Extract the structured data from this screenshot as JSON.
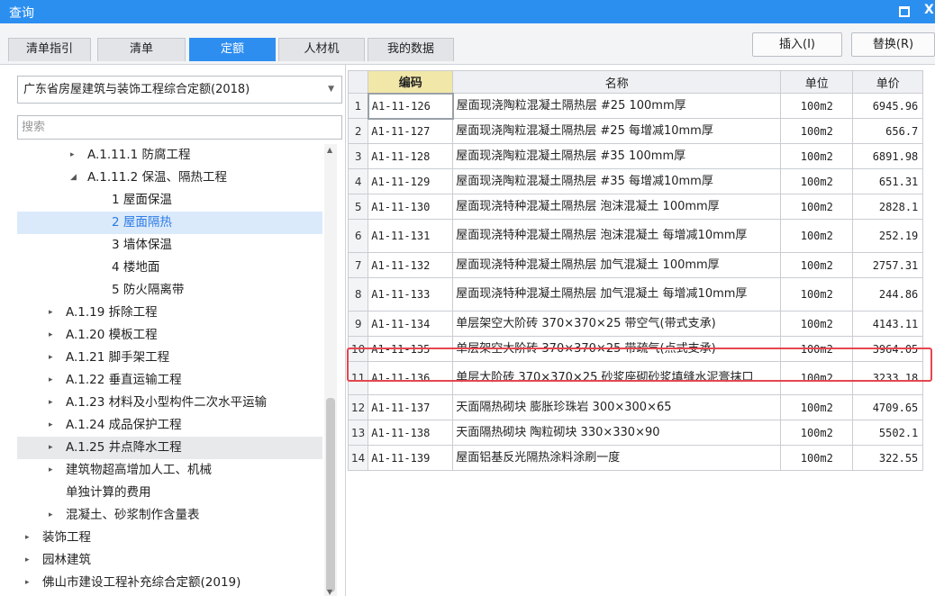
{
  "window": {
    "title": "查询",
    "close_glyph": "X"
  },
  "tabs": [
    {
      "label": "清单指引",
      "active": false
    },
    {
      "label": "清单",
      "active": false
    },
    {
      "label": "定额",
      "active": true
    },
    {
      "label": "人材机",
      "active": false
    },
    {
      "label": "我的数据",
      "active": false
    }
  ],
  "toolbar": {
    "insert_label": "插入(I)",
    "replace_label": "替换(R)"
  },
  "library": {
    "selected": "广东省房屋建筑与装饰工程综合定额(2018)"
  },
  "search": {
    "placeholder": "搜索"
  },
  "tree": [
    {
      "label": "A.1.11.1 防腐工程",
      "arrow": "▸"
    },
    {
      "label": "A.1.11.2 保温、隔热工程",
      "arrow": "◢"
    },
    {
      "label": "1 屋面保温",
      "arrow": ""
    },
    {
      "label": "2 屋面隔热",
      "arrow": ""
    },
    {
      "label": "3 墙体保温",
      "arrow": ""
    },
    {
      "label": "4 楼地面",
      "arrow": ""
    },
    {
      "label": "5 防火隔离带",
      "arrow": ""
    },
    {
      "label": "A.1.19 拆除工程",
      "arrow": "▸"
    },
    {
      "label": "A.1.20 模板工程",
      "arrow": "▸"
    },
    {
      "label": "A.1.21 脚手架工程",
      "arrow": "▸"
    },
    {
      "label": "A.1.22 垂直运输工程",
      "arrow": "▸"
    },
    {
      "label": "A.1.23 材料及小型构件二次水平运输",
      "arrow": "▸"
    },
    {
      "label": "A.1.24 成品保护工程",
      "arrow": "▸"
    },
    {
      "label": "A.1.25 井点降水工程",
      "arrow": "▸"
    },
    {
      "label": "建筑物超高增加人工、机械",
      "arrow": "▸"
    },
    {
      "label": "单独计算的费用",
      "arrow": ""
    },
    {
      "label": "混凝土、砂浆制作含量表",
      "arrow": "▸"
    },
    {
      "label": "装饰工程",
      "arrow": "▸"
    },
    {
      "label": "园林建筑",
      "arrow": "▸"
    },
    {
      "label": "佛山市建设工程补充综合定额(2019)",
      "arrow": "▸"
    }
  ],
  "table": {
    "headers": {
      "code": "编码",
      "name": "名称",
      "unit": "单位",
      "price": "单价"
    },
    "rows": [
      {
        "n": "1",
        "code": "A1-11-126",
        "name": "屋面现浇陶粒混凝土隔热层 #25 100mm厚",
        "unit": "100m2",
        "price": "6945.96"
      },
      {
        "n": "2",
        "code": "A1-11-127",
        "name": "屋面现浇陶粒混凝土隔热层 #25 每增减10mm厚",
        "unit": "100m2",
        "price": "656.7"
      },
      {
        "n": "3",
        "code": "A1-11-128",
        "name": "屋面现浇陶粒混凝土隔热层 #35 100mm厚",
        "unit": "100m2",
        "price": "6891.98"
      },
      {
        "n": "4",
        "code": "A1-11-129",
        "name": "屋面现浇陶粒混凝土隔热层 #35 每增减10mm厚",
        "unit": "100m2",
        "price": "651.31"
      },
      {
        "n": "5",
        "code": "A1-11-130",
        "name": "屋面现浇特种混凝土隔热层 泡沫混凝土 100mm厚",
        "unit": "100m2",
        "price": "2828.1"
      },
      {
        "n": "6",
        "code": "A1-11-131",
        "name": "屋面现浇特种混凝土隔热层 泡沫混凝土 每增减10mm厚",
        "unit": "100m2",
        "price": "252.19"
      },
      {
        "n": "7",
        "code": "A1-11-132",
        "name": "屋面现浇特种混凝土隔热层 加气混凝土 100mm厚",
        "unit": "100m2",
        "price": "2757.31"
      },
      {
        "n": "8",
        "code": "A1-11-133",
        "name": "屋面现浇特种混凝土隔热层 加气混凝土 每增减10mm厚",
        "unit": "100m2",
        "price": "244.86"
      },
      {
        "n": "9",
        "code": "A1-11-134",
        "name": "单层架空大阶砖 370×370×25 带空气(带式支承)",
        "unit": "100m2",
        "price": "4143.11"
      },
      {
        "n": "10",
        "code": "A1-11-135",
        "name": "单层架空大阶砖 370×370×25 带疏气(点式支承)",
        "unit": "100m2",
        "price": "3964.05"
      },
      {
        "n": "11",
        "code": "A1-11-136",
        "name": "单层大阶砖 370×370×25 砂浆座砌砂浆填缝水泥膏抹口",
        "unit": "100m2",
        "price": "3233.18"
      },
      {
        "n": "12",
        "code": "A1-11-137",
        "name": "天面隔热砌块 膨胀珍珠岩 300×300×65",
        "unit": "100m2",
        "price": "4709.65"
      },
      {
        "n": "13",
        "code": "A1-11-138",
        "name": "天面隔热砌块 陶粒砌块 330×330×90",
        "unit": "100m2",
        "price": "5502.1"
      },
      {
        "n": "14",
        "code": "A1-11-139",
        "name": "屋面铝基反光隔热涂料涂刷一度",
        "unit": "100m2",
        "price": "322.55"
      }
    ]
  }
}
